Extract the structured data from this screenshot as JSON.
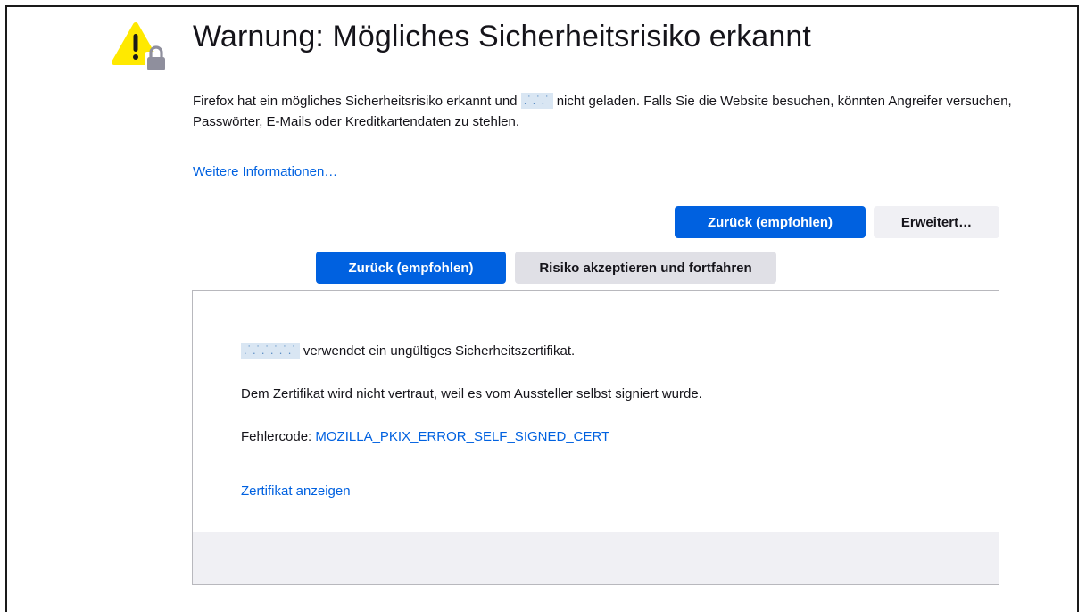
{
  "page": {
    "title": "Warnung: Mögliches Sicherheitsrisiko erkannt",
    "intro_before": "Firefox hat ein mögliches Sicherheitsrisiko erkannt und",
    "intro_redacted": ".˙.˙.˙",
    "intro_after": "nicht geladen. Falls Sie die Website besuchen, könnten Angreifer versuchen, Passwörter, E-Mails oder Kreditkartendaten zu stehlen.",
    "more_info_link": "Weitere Informationen…",
    "back_button": "Zurück (empfohlen)",
    "advanced_button": "Erweitert…"
  },
  "advanced": {
    "host_redacted": ".˙.˙.˙.˙.˙.˙",
    "invalid_cert_text": "verwendet ein ungültiges Sicherheitszertifikat.",
    "not_trusted_text": "Dem Zertifikat wird nicht vertraut, weil es vom Aussteller selbst signiert wurde.",
    "error_code_label": "Fehlercode:",
    "error_code": "MOZILLA_PKIX_ERROR_SELF_SIGNED_CERT",
    "view_cert_link": "Zertifikat anzeigen",
    "back_button": "Zurück (empfohlen)",
    "accept_button": "Risiko akzeptieren und fortfahren"
  },
  "colors": {
    "primary": "#0061e0",
    "warning": "#ffe900",
    "lock": "#8f8f9d",
    "footer_bg": "#f0f0f4"
  },
  "icons": {
    "warning": "warning-lock-icon"
  }
}
